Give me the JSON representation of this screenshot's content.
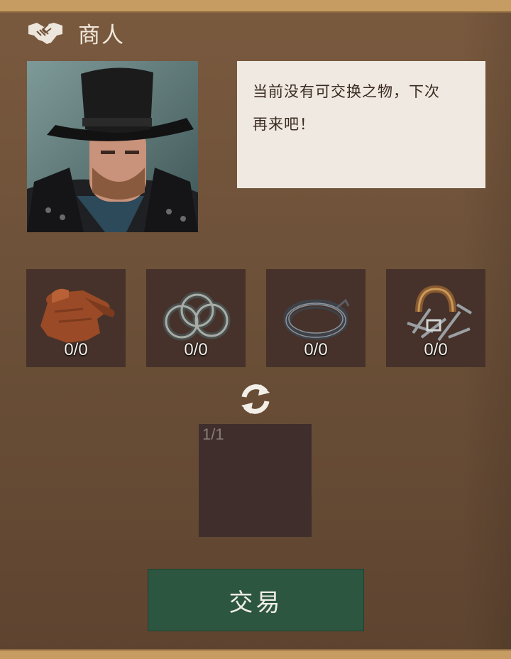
{
  "header": {
    "title": "商人",
    "icon": "handshake-icon"
  },
  "merchant": {
    "portrait": "merchant-portrait",
    "dialog": [
      "当前没有可交换之物，下次",
      "再来吧！"
    ]
  },
  "trade_items": [
    {
      "name": "leather",
      "icon": "leather-roll-icon",
      "count": "0/0"
    },
    {
      "name": "rings",
      "icon": "iron-rings-icon",
      "count": "0/0"
    },
    {
      "name": "wire",
      "icon": "wire-coil-icon",
      "count": "0/0"
    },
    {
      "name": "scrap",
      "icon": "horseshoe-scrap-icon",
      "count": "0/0"
    }
  ],
  "swap_icon": "refresh-icon",
  "result_slot": {
    "count": "1/1"
  },
  "trade_button": {
    "label": "交易"
  },
  "colors": {
    "background": "#6e5138",
    "slot": "#46322a",
    "result_slot": "#3f2e2c",
    "button": "#2c5640",
    "dialog_bg": "#efe9e2",
    "border": "#c69c62"
  }
}
